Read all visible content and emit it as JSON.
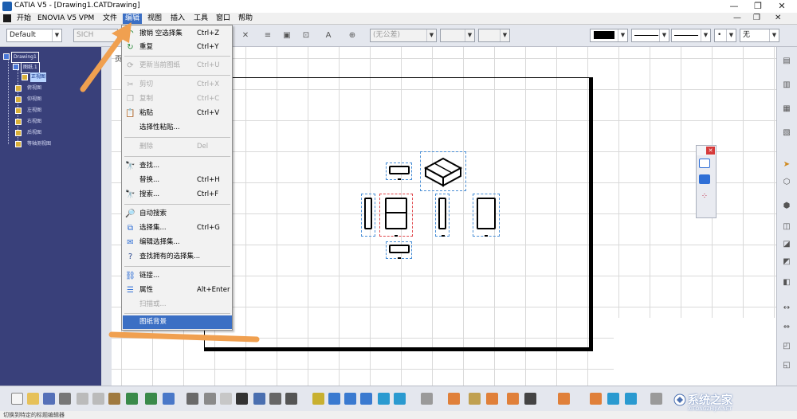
{
  "window": {
    "title": "CATIA V5 - [Drawing1.CATDrawing]",
    "controls": {
      "minimize": "—",
      "restore": "❐",
      "close": "✕"
    }
  },
  "menubar": {
    "items": [
      "开始",
      "ENOVIA V5 VPM",
      "文件",
      "编辑",
      "视图",
      "插入",
      "工具",
      "窗口",
      "帮助"
    ],
    "active": "编辑",
    "mdi_controls": {
      "minimize": "—",
      "restore": "❐",
      "close": "✕"
    }
  },
  "toolbar": {
    "style_combo": "Default",
    "font_combo": "SICH",
    "tolerance_combo": "(无公差)",
    "color_swatch": "#000000",
    "pattern_combo": "无"
  },
  "tree": {
    "root": "Drawing1",
    "sheet": "图纸.1",
    "views": [
      "正视图",
      "俯视图",
      "仰视图",
      "左视图",
      "右视图",
      "后视图",
      "等轴测视图"
    ],
    "selected_view_index": 0
  },
  "canvas": {
    "sheet_tab": "页"
  },
  "edit_menu": {
    "items": [
      {
        "icon": "undo-icon",
        "label": "撤销 空选择集",
        "shortcut": "Ctrl+Z",
        "enabled": true
      },
      {
        "icon": "redo-icon",
        "label": "重复",
        "shortcut": "Ctrl+Y",
        "enabled": true
      },
      {
        "icon": "update-icon",
        "label": "更新当前图纸",
        "shortcut": "Ctrl+U",
        "enabled": false
      },
      {
        "icon": "cut-icon",
        "label": "剪切",
        "shortcut": "Ctrl+X",
        "enabled": false
      },
      {
        "icon": "copy-icon",
        "label": "复制",
        "shortcut": "Ctrl+C",
        "enabled": false
      },
      {
        "icon": "paste-icon",
        "label": "粘贴",
        "shortcut": "Ctrl+V",
        "enabled": true
      },
      {
        "icon": "",
        "label": "选择性粘贴...",
        "shortcut": "",
        "enabled": true
      },
      {
        "icon": "",
        "label": "删除",
        "shortcut": "Del",
        "enabled": false
      },
      {
        "icon": "find-icon",
        "label": "查找...",
        "shortcut": "",
        "enabled": true
      },
      {
        "icon": "",
        "label": "替换...",
        "shortcut": "Ctrl+H",
        "enabled": true
      },
      {
        "icon": "search-icon",
        "label": "搜索...",
        "shortcut": "Ctrl+F",
        "enabled": true
      },
      {
        "icon": "auto-search-icon",
        "label": "自动搜索",
        "shortcut": "",
        "enabled": true
      },
      {
        "icon": "selection-set-icon",
        "label": "选择集...",
        "shortcut": "Ctrl+G",
        "enabled": true
      },
      {
        "icon": "edit-selection-set-icon",
        "label": "编辑选择集...",
        "shortcut": "",
        "enabled": true
      },
      {
        "icon": "find-owning-set-icon",
        "label": "查找拥有的选择集...",
        "shortcut": "",
        "enabled": true
      },
      {
        "icon": "links-icon",
        "label": "链接...",
        "shortcut": "",
        "enabled": true
      },
      {
        "icon": "properties-icon",
        "label": "属性",
        "shortcut": "Alt+Enter",
        "enabled": true
      },
      {
        "icon": "",
        "label": "扫描或...",
        "shortcut": "",
        "enabled": false
      },
      {
        "icon": "",
        "label": "图纸背景",
        "shortcut": "",
        "enabled": true,
        "highlighted": true
      }
    ]
  },
  "statusbar": {
    "text": "切换到特定的标题编辑器"
  },
  "watermark": {
    "text": "系统之家",
    "sub": "XITONGZHIJIA.NET"
  },
  "colors": {
    "menu_highlight": "#3b6fc4",
    "tree_background": "#39407a",
    "annotation_arrow": "#f0a050",
    "view_frame": "#4a8fd6",
    "active_view_frame": "#e0484c"
  }
}
